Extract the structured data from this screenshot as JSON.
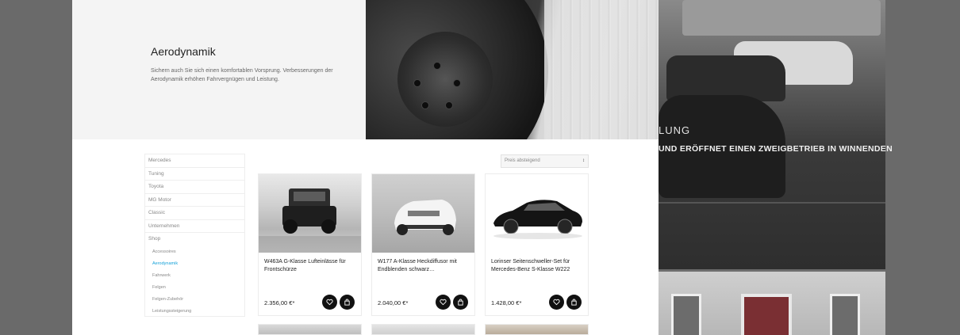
{
  "hero": {
    "title": "Aerodynamik",
    "description": "Sichern auch Sie sich einen komfortablen Vorsprung. Verbesserungen der Aerodynamik erhöhen Fahrvergnügen und Leistung."
  },
  "background_page": {
    "heading_partial": "LUNG",
    "subheading_partial": "UND ERÖFFNET EINEN ZWEIGBETRIEB IN WINNENDEN"
  },
  "sidebar": {
    "categories": [
      {
        "label": "Mercedes"
      },
      {
        "label": "Tuning"
      },
      {
        "label": "Toyota"
      },
      {
        "label": "MG Motor"
      },
      {
        "label": "Classic"
      },
      {
        "label": "Unternehmen"
      },
      {
        "label": "Shop"
      }
    ],
    "shop_subcategories": [
      {
        "label": "Accessoires"
      },
      {
        "label": "Aerodynamik",
        "active": true
      },
      {
        "label": "Fahrwerk"
      },
      {
        "label": "Felgen"
      },
      {
        "label": "Felgen-Zubehör"
      },
      {
        "label": "Leistungssteigerung"
      }
    ]
  },
  "sort": {
    "selected": "Preis absteigend"
  },
  "products": [
    {
      "title": "W463A G-Klasse Lufteinlässe für Frontschürze",
      "price": "2.356,00 €*"
    },
    {
      "title": "W177 A-Klasse Heckdiffusor mit Endblenden schwarz…",
      "price": "2.040,00 €*"
    },
    {
      "title": "Lorinser Seitenschweller-Set für Mercedes-Benz S-Klasse W222",
      "price": "1.428,00 €*"
    }
  ],
  "colors": {
    "accent": "#16a2d9",
    "button_dark": "#111111"
  },
  "icons": {
    "favorite": "heart-icon",
    "cart": "cart-icon",
    "calendar": "calendar-icon",
    "sort": "sort-arrows-icon"
  }
}
